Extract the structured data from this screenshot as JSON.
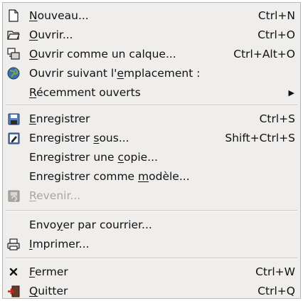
{
  "menu": {
    "items": [
      {
        "pre": "",
        "key": "N",
        "post": "ouveau...",
        "shortcut": "Ctrl+N",
        "icon": "new-document-icon"
      },
      {
        "pre": "",
        "key": "O",
        "post": "uvrir...",
        "shortcut": "Ctrl+O",
        "icon": "open-folder-icon"
      },
      {
        "pre": "",
        "key": "O",
        "post": "uvrir comme un calque...",
        "shortcut": "Ctrl+Alt+O",
        "icon": "open-as-layer-icon"
      },
      {
        "pre": "Ouvrir suivant l'",
        "key": "e",
        "post": "mplacement :",
        "shortcut": "",
        "icon": "globe-icon"
      },
      {
        "pre": "",
        "key": "R",
        "post": "écemment ouverts",
        "shortcut": "",
        "icon": ""
      },
      {
        "pre": "",
        "key": "E",
        "post": "nregistrer",
        "shortcut": "Ctrl+S",
        "icon": "save-icon"
      },
      {
        "pre": "Enregistrer ",
        "key": "s",
        "post": "ous...",
        "shortcut": "Shift+Ctrl+S",
        "icon": "save-as-icon"
      },
      {
        "pre": "Enregistrer une ",
        "key": "c",
        "post": "opie...",
        "shortcut": "",
        "icon": ""
      },
      {
        "pre": "Enregistrer comme ",
        "key": "m",
        "post": "odèle...",
        "shortcut": "",
        "icon": ""
      },
      {
        "pre": "",
        "key": "R",
        "post": "evenir...",
        "shortcut": "",
        "icon": "revert-icon"
      },
      {
        "pre": "Envo",
        "key": "y",
        "post": "er par courrier...",
        "shortcut": "",
        "icon": ""
      },
      {
        "pre": "",
        "key": "I",
        "post": "mprimer...",
        "shortcut": "",
        "icon": "printer-icon"
      },
      {
        "pre": "",
        "key": "F",
        "post": "ermer",
        "shortcut": "Ctrl+W",
        "icon": "close-icon"
      },
      {
        "pre": "",
        "key": "Q",
        "post": "uitter",
        "shortcut": "Ctrl+Q",
        "icon": "quit-icon"
      }
    ],
    "submenu_arrow": "▶"
  }
}
